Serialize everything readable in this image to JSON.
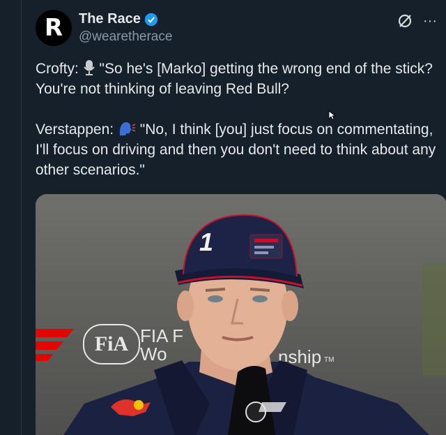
{
  "account": {
    "display_name": "The Race",
    "handle": "@wearetherace",
    "avatar_letter": "R"
  },
  "tweet": {
    "line1_prefix": "Crofty: ",
    "line1_icon": "microphone-emoji",
    "line1_quote": " \"So he's [Marko] getting the wrong end of the stick? You're not thinking of leaving Red Bull?",
    "line2_prefix": "Verstappen: ",
    "line2_icon": "speaking-head-emoji",
    "line2_quote": " \"No, I think [you] just focus on commentating, I'll focus on driving and then you don't need to think about any other scenarios.\""
  },
  "media": {
    "backdrop_fia": "FiA",
    "backdrop_text1": "FIA F",
    "backdrop_text2": "Wo",
    "backdrop_text3": "nship",
    "backdrop_tm": "TM",
    "cap_number": "1"
  },
  "colors": {
    "background": "#15202b",
    "verified": "#1d9bf0",
    "muted": "#8b98a5"
  }
}
